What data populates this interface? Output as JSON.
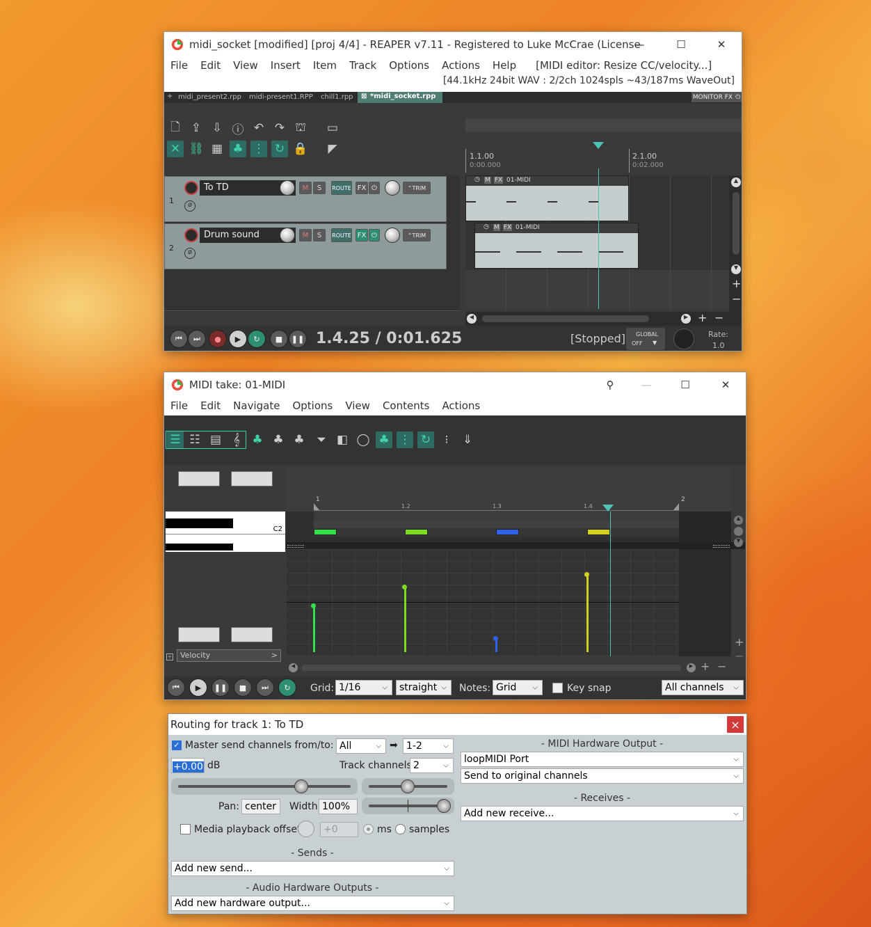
{
  "main_window": {
    "title": "midi_socket [modified] [proj 4/4] - REAPER v7.11 - Registered to Luke McCrae (Licensed for...",
    "menu": [
      "File",
      "Edit",
      "View",
      "Insert",
      "Item",
      "Track",
      "Options",
      "Actions",
      "Help"
    ],
    "status_action": "[MIDI editor: Resize CC/velocity...]",
    "audio_info": "[44.1kHz 24bit WAV : 2/2ch 1024spls ~43/187ms WaveOut]",
    "project_tabs": [
      "midi_present2.rpp",
      "midi-present1.RPP",
      "chill1.rpp",
      "*midi_socket.rpp"
    ],
    "new_tab_symbol": "+",
    "active_tab_marker": "⊠",
    "monitor_fx_label": "MONITOR FX",
    "ruler": {
      "marker1_bar": "1.1.00",
      "marker1_time": "0:00.000",
      "marker2_bar": "2.1.00",
      "marker2_time": "0:02.000"
    },
    "tracks": [
      {
        "number": "1",
        "name": "To TD",
        "mute": "M",
        "solo": "S",
        "route": "ROUTE",
        "fx": "FX",
        "trim": "TRIM",
        "fx_active": false
      },
      {
        "number": "2",
        "name": "Drum sound",
        "mute": "M",
        "solo": "S",
        "route": "ROUTE",
        "fx": "FX",
        "trim": "TRIM",
        "fx_active": true
      }
    ],
    "items": [
      {
        "name": "01-MIDI",
        "m": "M",
        "fx": "FX"
      },
      {
        "name": "01-MIDI",
        "m": "M",
        "fx": "FX"
      }
    ],
    "transport": {
      "position": "1.4.25 / 0:01.625",
      "status": "[Stopped]",
      "global_label": "GLOBAL",
      "global_state": "OFF",
      "rate_label": "Rate:",
      "rate_value": "1.0"
    }
  },
  "midi_window": {
    "title": "MIDI take: 01-MIDI",
    "menu": [
      "File",
      "Edit",
      "Navigate",
      "Options",
      "View",
      "Contents",
      "Actions"
    ],
    "ruler_labels": [
      "1",
      "1.2",
      "1.3",
      "1.4",
      "2"
    ],
    "key_label": "C2",
    "cc_lane_label": "Velocity",
    "cc_lane_arrow": ">",
    "notes": [
      {
        "beat": 1.0,
        "length": 0.25,
        "velocity": 60,
        "color": "#33e04a"
      },
      {
        "beat": 2.0,
        "length": 0.25,
        "velocity": 84,
        "color": "#7ddc22"
      },
      {
        "beat": 3.0,
        "length": 0.25,
        "velocity": 17,
        "color": "#2f62e6"
      },
      {
        "beat": 4.0,
        "length": 0.25,
        "velocity": 101,
        "color": "#d2d21e"
      }
    ],
    "playhead_beat": 4.25,
    "bottom": {
      "grid_label": "Grid:",
      "grid_value": "1/16",
      "grid_mode": "straight",
      "notes_label": "Notes:",
      "notes_value": "Grid",
      "key_snap_label": "Key snap",
      "key_snap_checked": false,
      "channels_value": "All channels"
    }
  },
  "routing_window": {
    "title": "Routing for track 1: To TD",
    "close": "×",
    "master_send_label": "Master send channels from/to:",
    "master_send_checked": true,
    "master_from": "All",
    "arrow": "➡",
    "master_to": "1-2",
    "volume_value": "+0.00",
    "db_label": "dB",
    "track_channels_label": "Track channels:",
    "track_channels_value": "2",
    "pan_label": "Pan:",
    "pan_value": "center",
    "width_label": "Width:",
    "width_value": "100%",
    "media_offset_label": "Media playback offset:",
    "media_offset_value": "+0",
    "ms_label": "ms",
    "samples_label": "samples",
    "sends_header": "- Sends -",
    "add_send": "Add new send...",
    "hw_outputs_header": "- Audio Hardware Outputs -",
    "add_hw_output": "Add new hardware output...",
    "midi_hw_header": "- MIDI Hardware Output -",
    "midi_port": "loopMIDI Port",
    "midi_channels": "Send to original channels",
    "receives_header": "- Receives -",
    "add_receive": "Add new receive..."
  },
  "colors": {
    "reaper_dark": "#3a3a3a",
    "track_panel": "#8e9a9b",
    "accent_teal": "#3fd2a6",
    "routing_bg": "#c9d0d3",
    "close_red": "#d23a3a"
  }
}
